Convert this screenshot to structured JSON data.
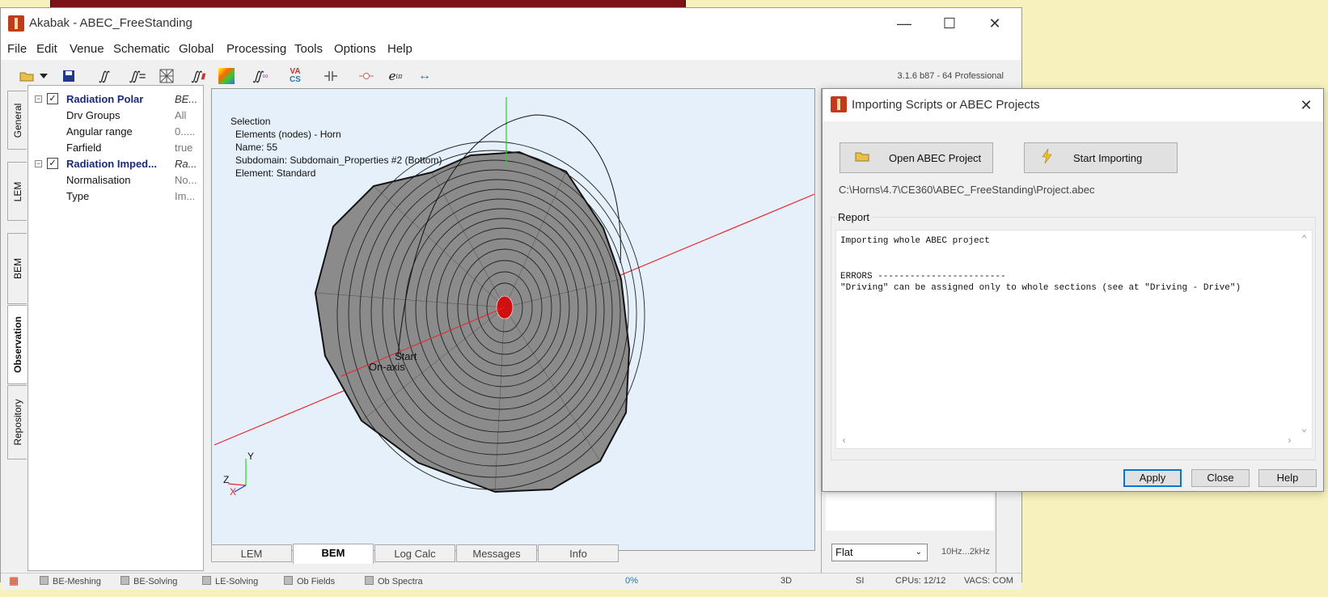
{
  "background": {
    "bottom_text": ""
  },
  "main_window": {
    "title": "Akabak - ABEC_FreeStanding",
    "menu": [
      "File",
      "Edit",
      "Venue",
      "Schematic",
      "Global",
      "Processing",
      "Tools",
      "Options",
      "Help"
    ],
    "version": "3.1.6 b87 - 64 Professional",
    "toolbar_icons": [
      "open-folder-icon",
      "dropdown-arrow-icon",
      "save-icon",
      "integral-icon",
      "integral-equals-icon",
      "mesh-icon",
      "integral-bars-icon",
      "spectrum-icon",
      "integral-curve-icon",
      "vacs-icon",
      "capacitor-icon",
      "node-icon",
      "euler-icon",
      "double-arrow-icon"
    ],
    "vacs_label": {
      "line1": "VA",
      "line2": "CS"
    },
    "euler_label": "e",
    "euler_sup": "iπ",
    "side_tabs": [
      {
        "label": "General",
        "active": false
      },
      {
        "label": "LEM",
        "active": false
      },
      {
        "label": "BEM",
        "active": false
      },
      {
        "label": "Observation",
        "active": true
      },
      {
        "label": "Repository",
        "active": false
      }
    ],
    "tree": [
      {
        "label": "Radiation Polar",
        "value": "BE...",
        "bold": true,
        "level": 0
      },
      {
        "label": "Drv Groups",
        "value": "All",
        "bold": false,
        "level": 1
      },
      {
        "label": "Angular range",
        "value": "0.....",
        "bold": false,
        "level": 1
      },
      {
        "label": "Farfield",
        "value": "true",
        "bold": false,
        "level": 1
      },
      {
        "label": "Radiation Imped...",
        "value": "Ra...",
        "bold": true,
        "level": 0
      },
      {
        "label": "Normalisation",
        "value": "No...",
        "bold": false,
        "level": 1
      },
      {
        "label": "Type",
        "value": "Im...",
        "bold": false,
        "level": 1
      }
    ],
    "viewport": {
      "selection_lines": [
        "Selection",
        "Elements (nodes) - Horn",
        "Name:   55",
        "Subdomain: Subdomain_Properties #2 (Bottom)",
        "Element: Standard"
      ],
      "overlay_labels": {
        "start": "Start",
        "on_axis": "On-axis"
      },
      "axis_labels": {
        "y": "Y",
        "z": "Z",
        "x": "X"
      },
      "colors": {
        "background": "#e5f0fb",
        "axis_red": "#e8252b",
        "axis_green": "#2bd02b",
        "mesh_fill": "#8f8f8f",
        "mesh_line": "#111111",
        "driver_red": "#d01010"
      }
    },
    "bottom_tabs": [
      {
        "label": "LEM",
        "active": false
      },
      {
        "label": "BEM",
        "active": true
      },
      {
        "label": "Log Calc",
        "active": false
      },
      {
        "label": "Messages",
        "active": false
      },
      {
        "label": "Info",
        "active": false
      }
    ],
    "right_panel": {
      "select_value": "Flat",
      "freq_range": "10Hz...2kHz"
    },
    "status_bar": {
      "items": [
        "BE-Meshing",
        "BE-Solving",
        "LE-Solving",
        "Ob Fields",
        "Ob Spectra"
      ],
      "progress": "0%",
      "mode": "3D",
      "units": "SI",
      "cpus": "CPUs: 12/12",
      "vacs": "VACS: COM"
    }
  },
  "dialog": {
    "title": "Importing Scripts or ABEC Projects",
    "open_button": "Open ABEC Project",
    "start_button": "Start Importing",
    "path": "C:\\Horns\\4.7\\CE360\\ABEC_FreeStanding\\Project.abec",
    "report_label": "Report",
    "report_lines": [
      "Importing whole ABEC project",
      "",
      "",
      "ERRORS ------------------------",
      "\"Driving\" can be assigned only to whole sections (see at \"Driving - Drive\")"
    ],
    "apply_button": "Apply",
    "close_button": "Close",
    "help_button": "Help"
  }
}
